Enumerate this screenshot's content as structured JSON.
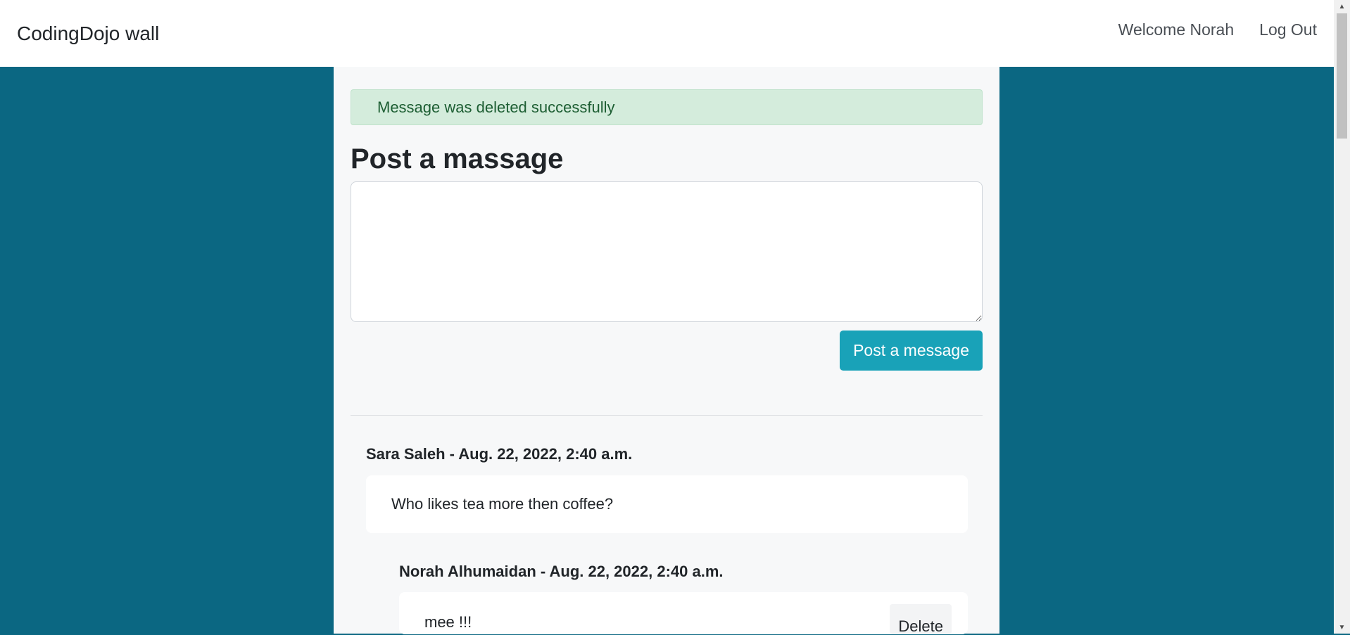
{
  "navbar": {
    "brand": "CodingDojo wall",
    "welcome": "Welcome Norah",
    "logout": "Log Out"
  },
  "alert": {
    "text": "Message was deleted successfully",
    "color": "#d4ecdc"
  },
  "post_form": {
    "title": "Post a massage",
    "input_value": "",
    "button_label": "Post a message"
  },
  "messages": [
    {
      "author": "Sara Saleh",
      "date": "Aug. 22, 2022, 2:40 a.m.",
      "header": "Sara Saleh - Aug. 22, 2022, 2:40 a.m.",
      "text": "Who likes tea more then coffee?",
      "comments": [
        {
          "author": "Norah Alhumaidan",
          "date": "Aug. 22, 2022, 2:40 a.m.",
          "header": "Norah Alhumaidan - Aug. 22, 2022, 2:40 a.m.",
          "text": "mee !!!",
          "delete_label": "Delete"
        }
      ]
    }
  ],
  "colors": {
    "page_background": "#0b6782",
    "accent_button": "#19a2b8",
    "panel_background": "#f7f8f9"
  },
  "icons": {
    "scroll_up": "scroll-up-arrow-icon",
    "scroll_down": "scroll-down-arrow-icon"
  }
}
